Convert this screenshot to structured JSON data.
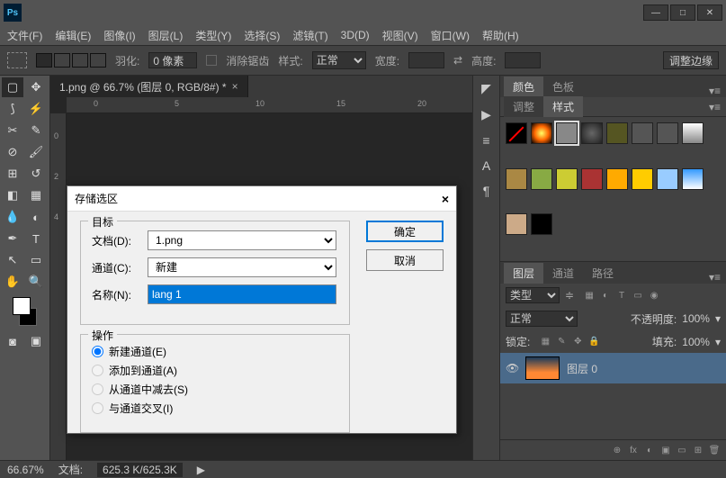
{
  "app": {
    "logo": "Ps"
  },
  "menu": [
    "文件(F)",
    "编辑(E)",
    "图像(I)",
    "图层(L)",
    "类型(Y)",
    "选择(S)",
    "滤镜(T)",
    "3D(D)",
    "视图(V)",
    "窗口(W)",
    "帮助(H)"
  ],
  "options": {
    "feather_label": "羽化:",
    "feather_value": "0 像素",
    "antialias": "消除锯齿",
    "style_label": "样式:",
    "style_value": "正常",
    "width_label": "宽度:",
    "height_label": "高度:",
    "refine_edge": "调整边缘"
  },
  "doc_tab": {
    "title": "1.png @ 66.7% (图层 0, RGB/8#) *",
    "close": "×"
  },
  "ruler_h": [
    "0",
    "5",
    "10",
    "15",
    "20"
  ],
  "ruler_v": [
    "0",
    "2",
    "4"
  ],
  "side_icons": [
    "◤",
    "▶",
    "≡",
    "A",
    "¶"
  ],
  "color_panel": {
    "tab1": "颜色",
    "tab2": "色板",
    "sub1": "调整",
    "sub2": "样式"
  },
  "swatches": [
    "#000",
    "#ff6600",
    "#888",
    "#444",
    "#552",
    "#555",
    "#555",
    "linear-gradient(#fff,#888)",
    "#a84",
    "#8a4",
    "#cc3",
    "#a33",
    "#fa0",
    "#fc0",
    "#9cf",
    "linear-gradient(#39f,#fff)",
    "#ca8",
    "#000",
    "#555"
  ],
  "layers_panel": {
    "tabs": [
      "图层",
      "通道",
      "路径"
    ],
    "kind_label": "类型",
    "blend": "正常",
    "opacity_label": "不透明度:",
    "opacity": "100%",
    "lock_label": "锁定:",
    "fill_label": "填充:",
    "fill": "100%",
    "layer_name": "图层 0"
  },
  "status": {
    "zoom": "66.67%",
    "doc_label": "文档:",
    "doc_size": "625.3 K/625.3K"
  },
  "dialog": {
    "title": "存储选区",
    "close": "×",
    "target_legend": "目标",
    "doc_label": "文档(D):",
    "doc_value": "1.png",
    "channel_label": "通道(C):",
    "channel_value": "新建",
    "name_label": "名称(N):",
    "name_value": "lang 1",
    "op_legend": "操作",
    "op1": "新建通道(E)",
    "op2": "添加到通道(A)",
    "op3": "从通道中减去(S)",
    "op4": "与通道交叉(I)",
    "ok": "确定",
    "cancel": "取消"
  }
}
